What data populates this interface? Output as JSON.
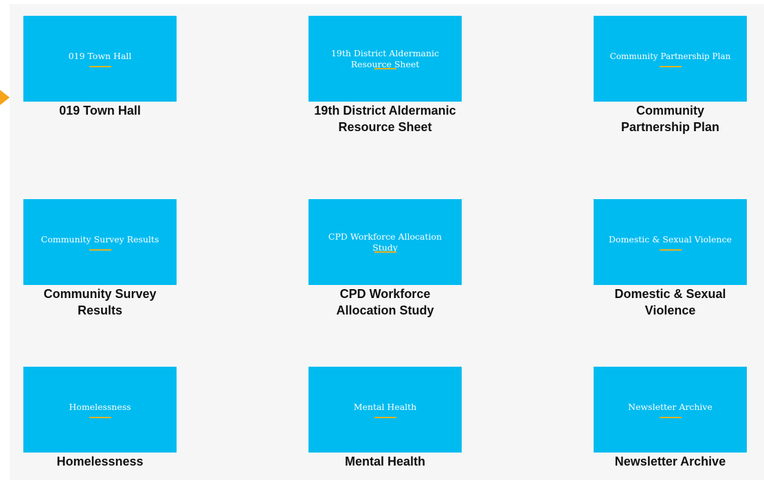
{
  "colors": {
    "tile": "#00bbf0",
    "tile_rule": "#e8b21a",
    "pointer_arrow": "#f5a31a",
    "panel_background": "#f6f6f6"
  },
  "icons": {
    "pointer": "arrow-right-icon"
  },
  "cards": [
    {
      "thumb_text": "019 Town Hall",
      "caption": "019 Town Hall"
    },
    {
      "thumb_text": "19th District Aldermanic Resource Sheet",
      "caption": "19th District Aldermanic Resource Sheet"
    },
    {
      "thumb_text": "Community Partnership Plan",
      "caption": "Community Partnership Plan"
    },
    {
      "thumb_text": "Community Survey Results",
      "caption": "Community Survey Results"
    },
    {
      "thumb_text": "CPD Workforce Allocation Study",
      "caption": "CPD Workforce Allocation Study"
    },
    {
      "thumb_text": "Domestic & Sexual Violence",
      "caption": "Domestic & Sexual Violence"
    },
    {
      "thumb_text": "Homelessness",
      "caption": "Homelessness"
    },
    {
      "thumb_text": "Mental Health",
      "caption": "Mental Health"
    },
    {
      "thumb_text": "Newsletter Archive",
      "caption": "Newsletter Archive"
    }
  ]
}
